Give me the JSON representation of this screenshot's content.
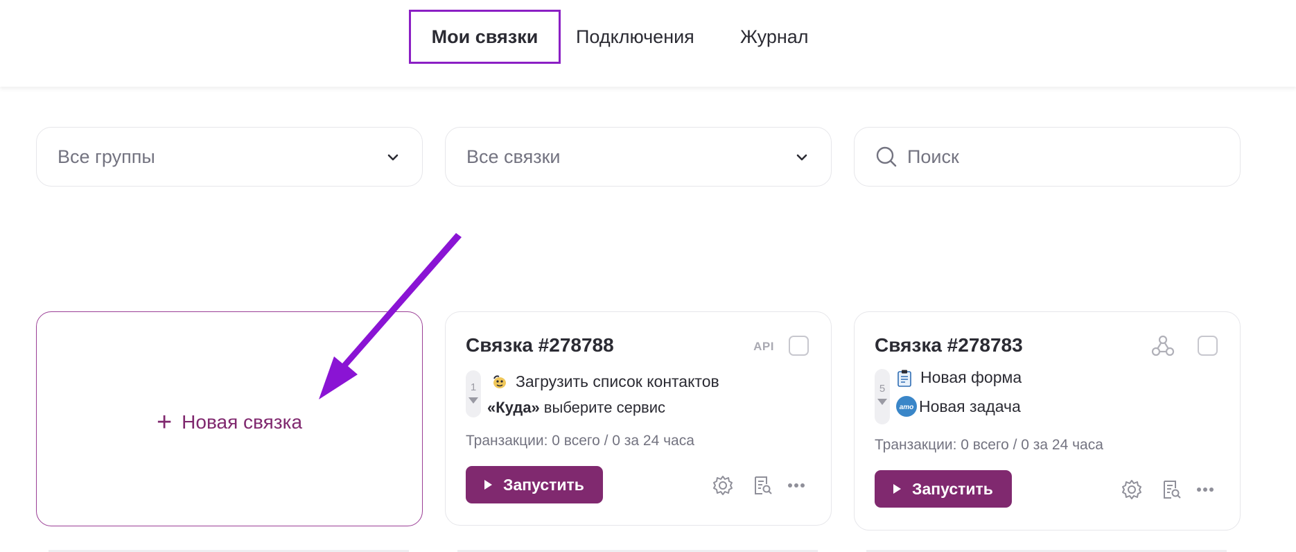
{
  "nav": {
    "tabs": [
      {
        "label": "Мои связки",
        "active": true
      },
      {
        "label": "Подключения",
        "active": false
      },
      {
        "label": "Журнал",
        "active": false
      }
    ]
  },
  "filters": {
    "groups_value": "Все группы",
    "links_value": "Все связки",
    "search_placeholder": "Поиск"
  },
  "new_link": {
    "label": "Новая связка"
  },
  "cards": [
    {
      "title": "Связка #278788",
      "badge": "API",
      "count": "1",
      "step1": {
        "icon": "mailchimp-icon",
        "text": "Загрузить список контактов"
      },
      "step2": {
        "prefix": "«Куда»",
        "text": "выберите сервис"
      },
      "transactions": "Транзакции: 0 всего / 0 за 24 часа",
      "run_label": "Запустить"
    },
    {
      "title": "Связка #278783",
      "badge_icon": "webhook-icon",
      "count": "5",
      "step1": {
        "icon": "clipboard-icon",
        "text": "Новая форма"
      },
      "step2": {
        "icon": "amocrm-icon",
        "icon_text": "amo",
        "text": "Новая задача"
      },
      "transactions": "Транзакции: 0 всего / 0 за 24 часа",
      "run_label": "Запустить"
    }
  ],
  "colors": {
    "accent": "#80296f",
    "tab_border": "#8b1fc4",
    "arrow": "#8a14d4",
    "amocrm": "#3a86c8"
  }
}
